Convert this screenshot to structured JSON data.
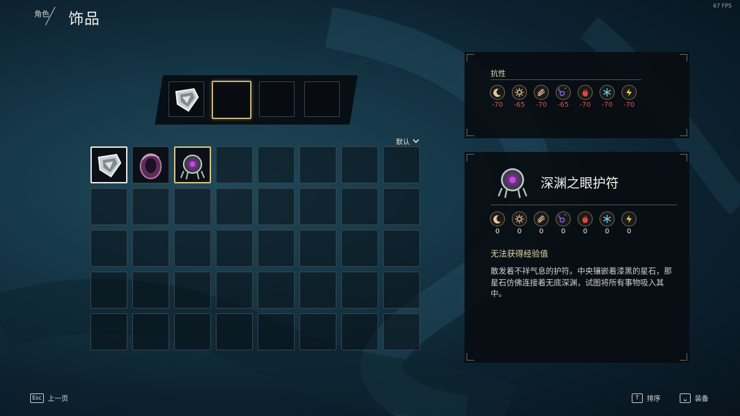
{
  "fps": "67 FPS",
  "header": {
    "breadcrumb": "角色",
    "title": "饰品"
  },
  "sort": {
    "label": "默认"
  },
  "inventory": {
    "items": [
      "shield-amulet",
      "purple-ring",
      "abyss-eye-amulet"
    ],
    "cells": 40
  },
  "resistance": {
    "title": "抗性",
    "icons": [
      "crescent-icon",
      "sun-icon",
      "claw-icon",
      "vortex-icon",
      "fire-icon",
      "frost-icon",
      "lightning-icon"
    ],
    "values": [
      "-70",
      "-65",
      "-70",
      "-65",
      "-70",
      "-70",
      "-70"
    ]
  },
  "item": {
    "name": "深渊之眼护符",
    "values": [
      "0",
      "0",
      "0",
      "0",
      "0",
      "0",
      "0"
    ],
    "xp_note": "无法获得经验值",
    "description": "散发着不祥气息的护符。中央镶嵌着漆黑的星石，那星石仿佛连接着无底深渊，试图将所有事物吸入其中。"
  },
  "footer": {
    "back_key": "Esc",
    "back_label": "上一页",
    "sort_key": "T",
    "sort_label": "排序",
    "equip_key": "␣",
    "equip_label": "装备"
  }
}
